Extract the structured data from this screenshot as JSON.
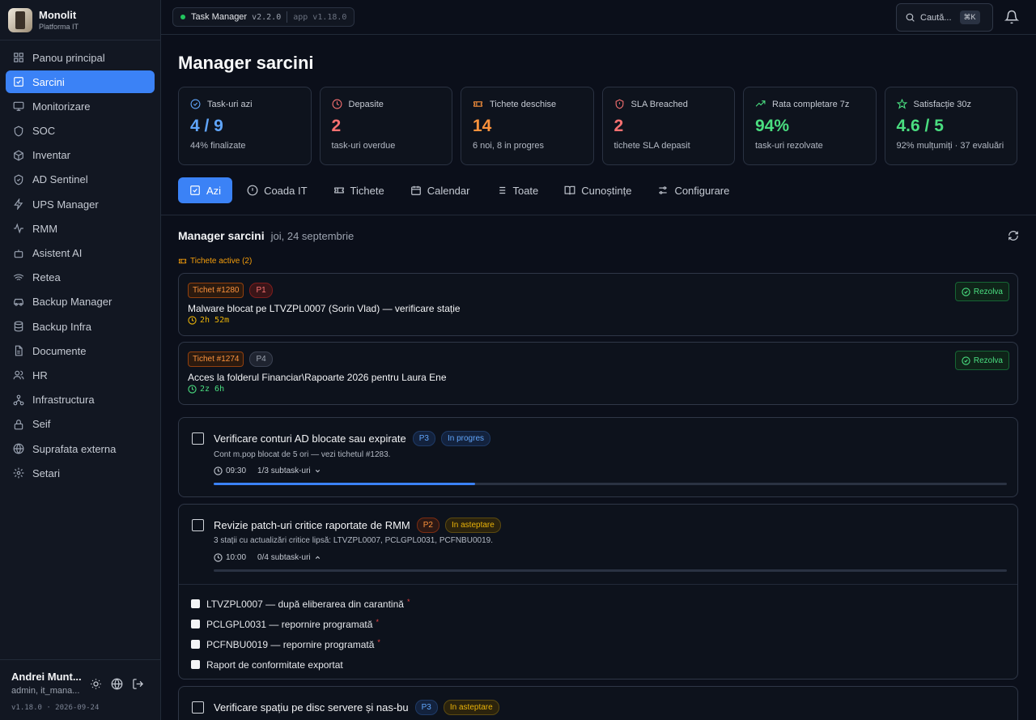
{
  "brand": {
    "name": "Monolit",
    "subtitle": "Platforma IT"
  },
  "sidebar": {
    "items": [
      {
        "label": "Panou principal",
        "icon": "grid-icon"
      },
      {
        "label": "Sarcini",
        "icon": "checkbox-icon",
        "active": true
      },
      {
        "label": "Monitorizare",
        "icon": "monitor-icon"
      },
      {
        "label": "SOC",
        "icon": "shield-icon"
      },
      {
        "label": "Inventar",
        "icon": "box-icon"
      },
      {
        "label": "AD Sentinel",
        "icon": "shield-check-icon"
      },
      {
        "label": "UPS Manager",
        "icon": "bolt-icon"
      },
      {
        "label": "RMM",
        "icon": "activity-icon"
      },
      {
        "label": "Asistent AI",
        "icon": "bot-icon"
      },
      {
        "label": "Retea",
        "icon": "wifi-icon"
      },
      {
        "label": "Backup Manager",
        "icon": "car-icon"
      },
      {
        "label": "Backup Infra",
        "icon": "database-icon"
      },
      {
        "label": "Documente",
        "icon": "file-icon"
      },
      {
        "label": "HR",
        "icon": "users-icon"
      },
      {
        "label": "Infrastructura",
        "icon": "network-icon"
      },
      {
        "label": "Seif",
        "icon": "lock-icon"
      },
      {
        "label": "Suprafata externa",
        "icon": "globe-icon"
      },
      {
        "label": "Setari",
        "icon": "gear-icon"
      }
    ]
  },
  "user": {
    "name": "Andrei Munt...",
    "role": "admin, it_mana...",
    "version": "v1.18.0 · 2026-09-24"
  },
  "topbar": {
    "app_name": "Task Manager",
    "app_version": "v2.2.0",
    "platform_version": "app v1.18.0",
    "search_placeholder": "Caută...",
    "shortcut": "⌘K"
  },
  "page": {
    "title": "Manager sarcini"
  },
  "stats": [
    {
      "label": "Task-uri azi",
      "value": "4 / 9",
      "sub": "44% finalizate",
      "color": "#60a5fa",
      "icon": "check-circle-icon"
    },
    {
      "label": "Depasite",
      "value": "2",
      "sub": "task-uri overdue",
      "color": "#f87171",
      "icon": "clock-icon"
    },
    {
      "label": "Tichete deschise",
      "value": "14",
      "sub": "6 noi, 8 in progres",
      "color": "#fb923c",
      "icon": "ticket-icon"
    },
    {
      "label": "SLA Breached",
      "value": "2",
      "sub": "tichete SLA depasit",
      "color": "#f87171",
      "icon": "shield-alert-icon"
    },
    {
      "label": "Rata completare 7z",
      "value": "94%",
      "sub": "task-uri rezolvate",
      "color": "#4ade80",
      "icon": "trending-up-icon"
    },
    {
      "label": "Satisfacție 30z",
      "value": "4.6 / 5",
      "sub": "92% mulțumiți · 37 evaluări",
      "color": "#4ade80",
      "icon": "star-icon"
    }
  ],
  "tabs": [
    {
      "label": "Azi",
      "active": true
    },
    {
      "label": "Coada IT"
    },
    {
      "label": "Tichete"
    },
    {
      "label": "Calendar"
    },
    {
      "label": "Toate"
    },
    {
      "label": "Cunoștințe"
    },
    {
      "label": "Configurare"
    }
  ],
  "section": {
    "title": "Manager sarcini",
    "date": "joi, 24 septembrie",
    "tickets_label": "Tichete active (2)"
  },
  "tickets": [
    {
      "id": "Tichet #1280",
      "priority": "P1",
      "title": "Malware blocat pe LTVZPL0007 (Sorin Vlad) — verificare stație",
      "timer": "2h 52m",
      "timer_color": "#eab308",
      "action": "Rezolva"
    },
    {
      "id": "Tichet #1274",
      "priority": "P4",
      "title": "Acces la folderul Financiar\\Rapoarte 2026 pentru Laura Ene",
      "timer": "2z 6h",
      "timer_color": "#4ade80",
      "action": "Rezolva"
    }
  ],
  "tasks": [
    {
      "title": "Verificare conturi AD blocate sau expirate",
      "priority": "P3",
      "status": "In progres",
      "desc": "Cont m.pop blocat de 5 ori — vezi tichetul #1283.",
      "time": "09:30",
      "subtasks_label": "1/3 subtask-uri",
      "progress": 0.33
    },
    {
      "title": "Revizie patch-uri critice raportate de RMM",
      "priority": "P2",
      "status": "In asteptare",
      "desc": "3 stații cu actualizări critice lipsă: LTVZPL0007, PCLGPL0031, PCFNBU0019.",
      "time": "10:00",
      "subtasks_label": "0/4 subtask-uri",
      "progress": 0,
      "subtasks": [
        {
          "label": "LTVZPL0007 — după eliberarea din carantină",
          "required": true
        },
        {
          "label": "PCLGPL0031 — repornire programată",
          "required": true
        },
        {
          "label": "PCFNBU0019 — repornire programată",
          "required": true
        },
        {
          "label": "Raport de conformitate exportat",
          "required": false
        }
      ]
    },
    {
      "title": "Verificare spațiu pe disc servere și nas-bu",
      "priority": "P3",
      "status": "In asteptare"
    }
  ],
  "required_mark": "*"
}
